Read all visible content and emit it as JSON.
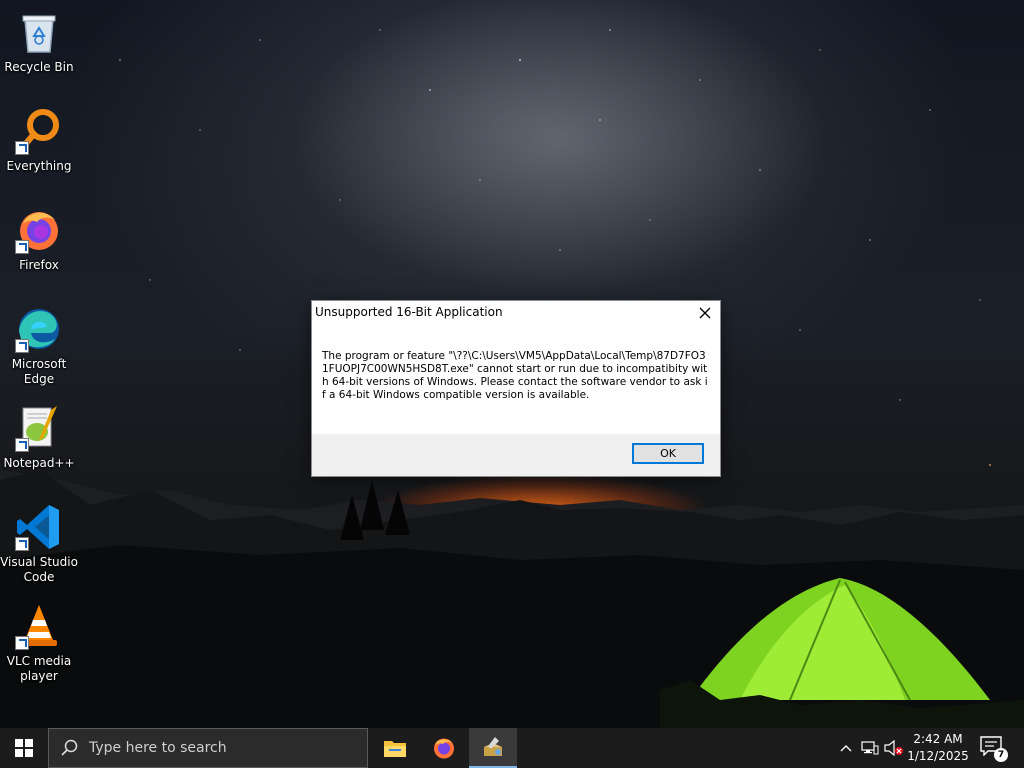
{
  "desktop": {
    "icons": [
      {
        "label": "Recycle Bin"
      },
      {
        "label": "Everything"
      },
      {
        "label": "Firefox"
      },
      {
        "label": "Microsoft Edge"
      },
      {
        "label": "Notepad++"
      },
      {
        "label": "Visual Studio Code"
      },
      {
        "label": "VLC media player"
      }
    ]
  },
  "dialog": {
    "title": "Unsupported 16-Bit Application",
    "message": "The program or feature \"\\??\\C:\\Users\\VM5\\AppData\\Local\\Temp\\87D7FO31FUOPJ7C00WN5HSD8T.exe\" cannot start or run due to incompatibity with 64-bit versions of Windows. Please contact the software vendor to ask if a 64-bit Windows compatible version is available.",
    "ok_label": "OK",
    "close_icon": "close-icon"
  },
  "taskbar": {
    "search_placeholder": "Type here to search",
    "pinned": [
      "file-explorer-icon",
      "firefox-icon",
      "installer-icon"
    ],
    "clock_time": "2:42 AM",
    "clock_date": "1/12/2025",
    "notification_count": "7",
    "accent": "#0078d7"
  }
}
